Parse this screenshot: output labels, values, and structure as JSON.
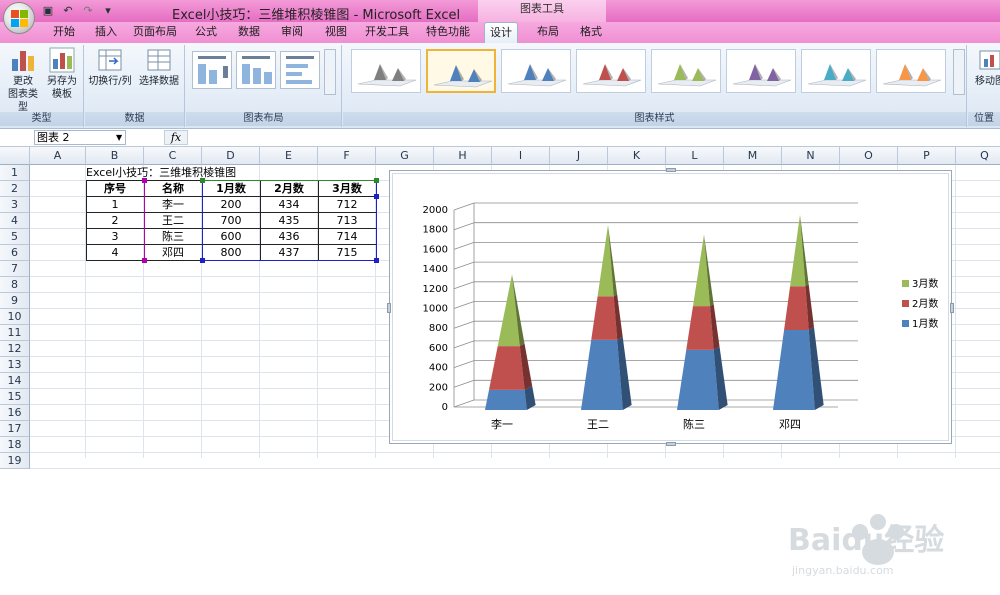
{
  "app": {
    "title": "Excel小技巧：三维堆积棱锥图 - Microsoft Excel",
    "context_group": "图表工具"
  },
  "tabs": [
    {
      "label": "开始"
    },
    {
      "label": "插入"
    },
    {
      "label": "页面布局"
    },
    {
      "label": "公式"
    },
    {
      "label": "数据"
    },
    {
      "label": "审阅"
    },
    {
      "label": "视图"
    },
    {
      "label": "开发工具"
    },
    {
      "label": "特色功能"
    },
    {
      "label": "设计",
      "active": true
    },
    {
      "label": "布局"
    },
    {
      "label": "格式"
    }
  ],
  "ribbon": {
    "groups": {
      "type": {
        "label": "类型",
        "change_type": "更改\n图表类型",
        "save_template": "另存为\n模板"
      },
      "data": {
        "label": "数据",
        "switch_row_col": "切换行/列",
        "select_data": "选择数据"
      },
      "layout": {
        "label": "图表布局"
      },
      "styles": {
        "label": "图表样式"
      },
      "location": {
        "label": "位置",
        "move_chart": "移动图"
      }
    },
    "style_colors": [
      "#7f7f7f",
      "#4f81bd",
      "#4f81bd",
      "#c0504d",
      "#9bbb59",
      "#8064a2",
      "#4bacc6",
      "#f79646"
    ]
  },
  "formula_bar": {
    "name_box": "图表 2",
    "fx": "fx",
    "content": ""
  },
  "columns": [
    "A",
    "B",
    "C",
    "D",
    "E",
    "F",
    "G",
    "H",
    "I",
    "J",
    "K",
    "L",
    "M",
    "N",
    "O",
    "P",
    "Q"
  ],
  "rows": [
    "1",
    "2",
    "3",
    "4",
    "5",
    "6",
    "7",
    "8",
    "9",
    "10",
    "11",
    "12",
    "13",
    "14",
    "15",
    "16",
    "17",
    "18",
    "19"
  ],
  "table": {
    "title": "Excel小技巧：三维堆积棱锥图",
    "headers": [
      "序号",
      "名称",
      "1月数",
      "2月数",
      "3月数"
    ],
    "rows": [
      [
        "1",
        "李一",
        "200",
        "434",
        "712"
      ],
      [
        "2",
        "王二",
        "700",
        "435",
        "713"
      ],
      [
        "3",
        "陈三",
        "600",
        "436",
        "714"
      ],
      [
        "4",
        "邓四",
        "800",
        "437",
        "715"
      ]
    ]
  },
  "chart_data": {
    "type": "bar",
    "subtype": "3d-stacked-pyramid",
    "categories": [
      "李一",
      "王二",
      "陈三",
      "邓四"
    ],
    "series": [
      {
        "name": "1月数",
        "values": [
          200,
          700,
          600,
          800
        ],
        "color": "#4f81bd"
      },
      {
        "name": "2月数",
        "values": [
          434,
          435,
          436,
          437
        ],
        "color": "#c0504d"
      },
      {
        "name": "3月数",
        "values": [
          712,
          713,
          714,
          715
        ],
        "color": "#9bbb59"
      }
    ],
    "legend_labels": [
      "3月数",
      "2月数",
      "1月数"
    ],
    "yticks": [
      "0",
      "200",
      "400",
      "600",
      "800",
      "1000",
      "1200",
      "1400",
      "1600",
      "1800",
      "2000"
    ],
    "ylim": [
      0,
      2000
    ],
    "grid": true,
    "legend": "right"
  },
  "watermark": {
    "text": "Baidu经验",
    "subtext": "jingyan.baidu.com"
  }
}
